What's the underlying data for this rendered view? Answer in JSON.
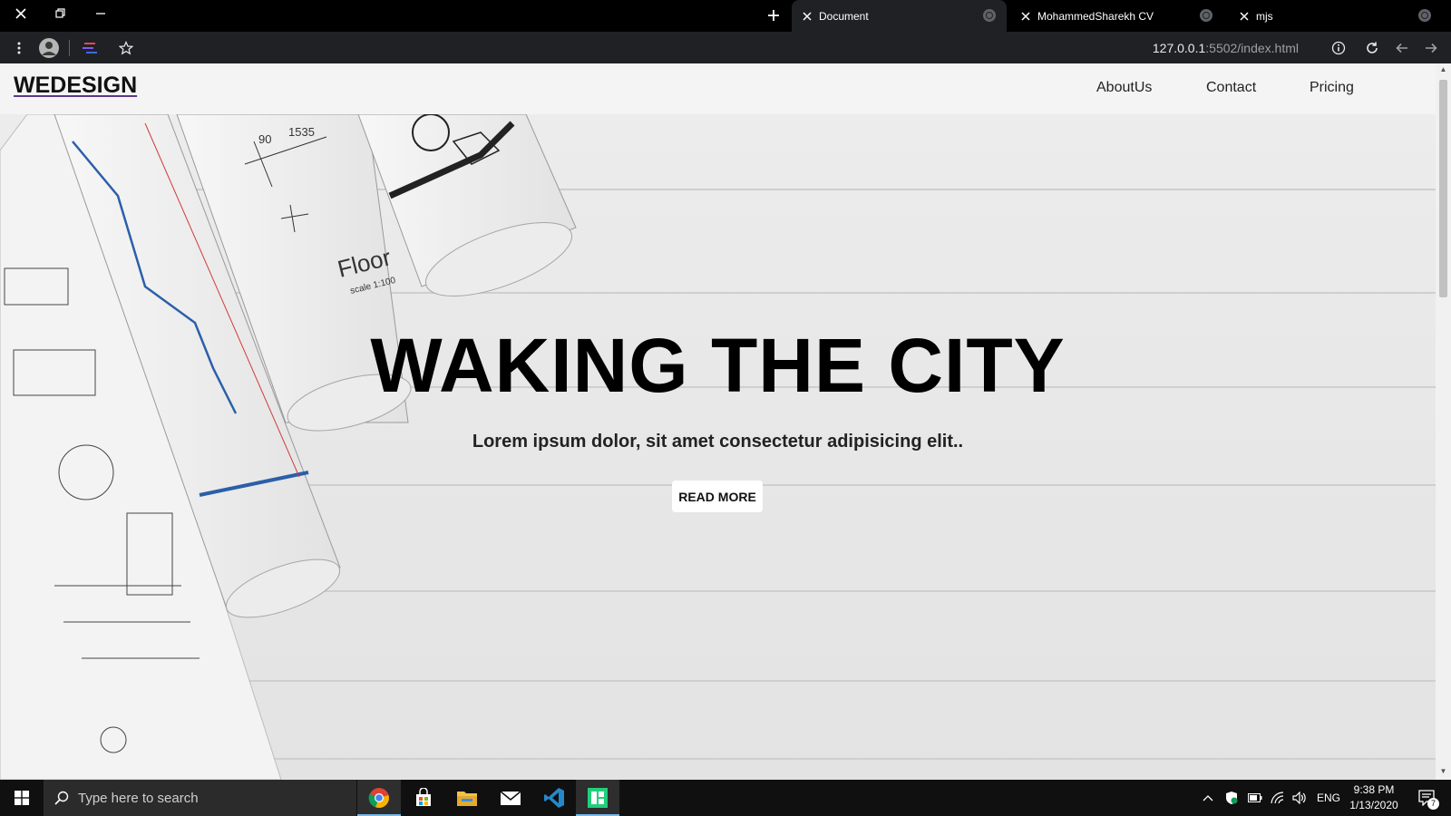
{
  "browser": {
    "tabs": [
      {
        "title": "Document",
        "active": true
      },
      {
        "title": "MohammedSharekh CV",
        "active": false
      },
      {
        "title": "mjs",
        "active": false
      }
    ],
    "url_host": "127.0.0.1",
    "url_rest": ":5502/index.html"
  },
  "site": {
    "logo": "WEDESIGN",
    "nav": [
      "AboutUs",
      "Contact",
      "Pricing"
    ],
    "hero_title": "WAKING THE CITY",
    "hero_subtitle": "Lorem ipsum dolor, sit amet consectetur adipisicing elit..",
    "cta_label": "READ MORE",
    "blueprint_label": "Floor",
    "blueprint_scale": "scale 1:100",
    "blueprint_dim_1": "90",
    "blueprint_dim_2": "1535"
  },
  "taskbar": {
    "search_placeholder": "Type here to search",
    "language": "ENG",
    "time": "9:38 PM",
    "date": "1/13/2020",
    "notification_count": "7"
  },
  "colors": {
    "accent": "#76b9ed",
    "logo_underline": "#5b3a86",
    "blueprint_blue": "#2b5fa8",
    "blueprint_red": "#d23a3a"
  }
}
